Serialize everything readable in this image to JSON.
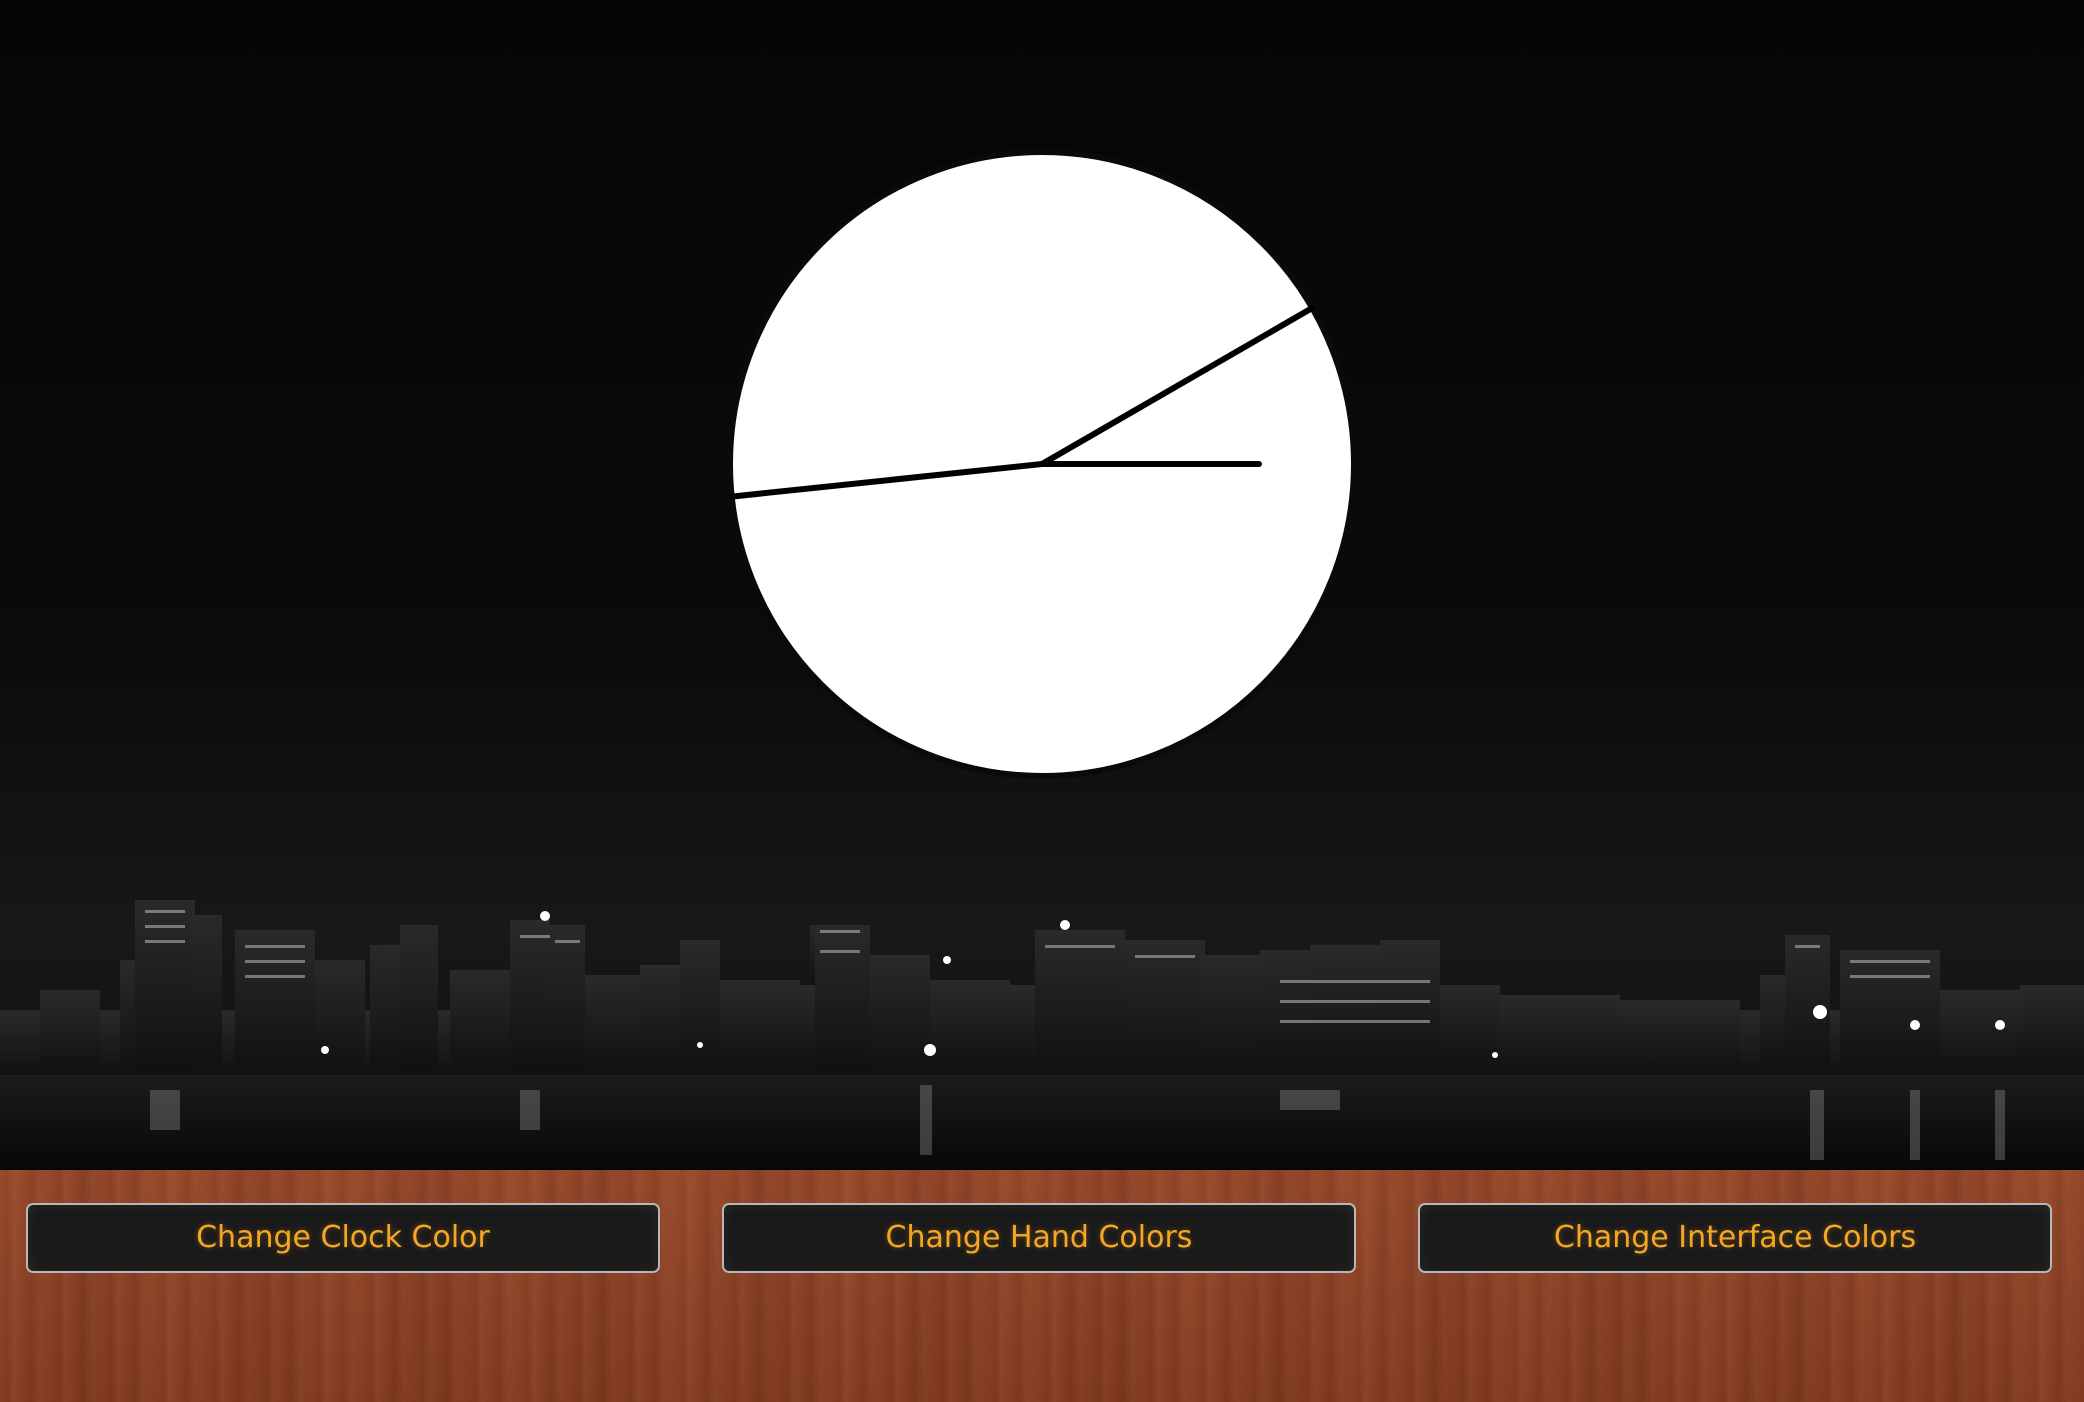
{
  "clock": {
    "face_color": "#ffffff",
    "rim_color": "#0a0a0a",
    "hand_color": "#000000",
    "hands": {
      "hour_angle_deg": 90,
      "minute_angle_deg": 60,
      "second_angle_deg": 264
    }
  },
  "background": {
    "sky_color": "#050505",
    "wood_color": "#8e4427"
  },
  "buttons": {
    "clock_color_label": "Change Clock Color",
    "hand_colors_label": "Change Hand Colors",
    "interface_colors_label": "Change Interface Colors",
    "text_color": "#f5a623",
    "background_color": "#1a1a1a"
  }
}
